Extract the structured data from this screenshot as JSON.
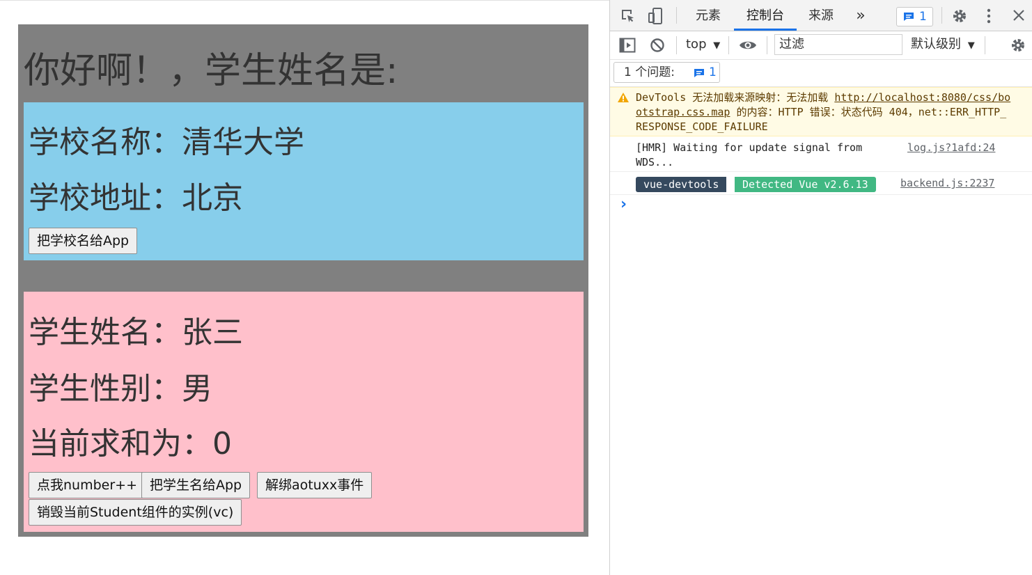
{
  "app": {
    "title": "你好啊！，学生姓名是:",
    "school": {
      "name_line": "学校名称：清华大学",
      "address_line": "学校地址：北京",
      "send_button": "把学校名给App",
      "bg_color": "#87ceeb"
    },
    "student": {
      "name_line": "学生姓名：张三",
      "gender_line": "学生性别：男",
      "sum_line": "当前求和为：0",
      "buttons": [
        "点我number++",
        "把学生名给App",
        "解绑aotuxx事件",
        "销毁当前Student组件的实例(vc)"
      ],
      "bg_color": "#ffc0cb"
    },
    "bg_color": "#808080"
  },
  "devtools": {
    "tabs": [
      "元素",
      "控制台",
      "来源"
    ],
    "active_tab": "控制台",
    "more_tabs_symbol": "»",
    "issues_badge_count": "1",
    "toolbar": {
      "context": "top",
      "filter_placeholder": "过滤",
      "level": "默认级别"
    },
    "issues_summary": {
      "label": "1 个问题:",
      "count": "1"
    },
    "console": {
      "warning": {
        "text_before": "DevTools 无法加载来源映射：无法加载 ",
        "link": "http://localhost:8080/css/bootstrap.css.map",
        "text_after": " 的内容：HTTP 错误：状态代码 404，net::ERR_HTTP_RESPONSE_CODE_FAILURE"
      },
      "hmr": {
        "text": "[HMR] Waiting for update signal from WDS...",
        "source": "log.js?1afd:24"
      },
      "vue": {
        "tag": "vue-devtools",
        "detected": "Detected Vue v2.6.13",
        "source": "backend.js:2237"
      },
      "prompt": "›"
    }
  }
}
